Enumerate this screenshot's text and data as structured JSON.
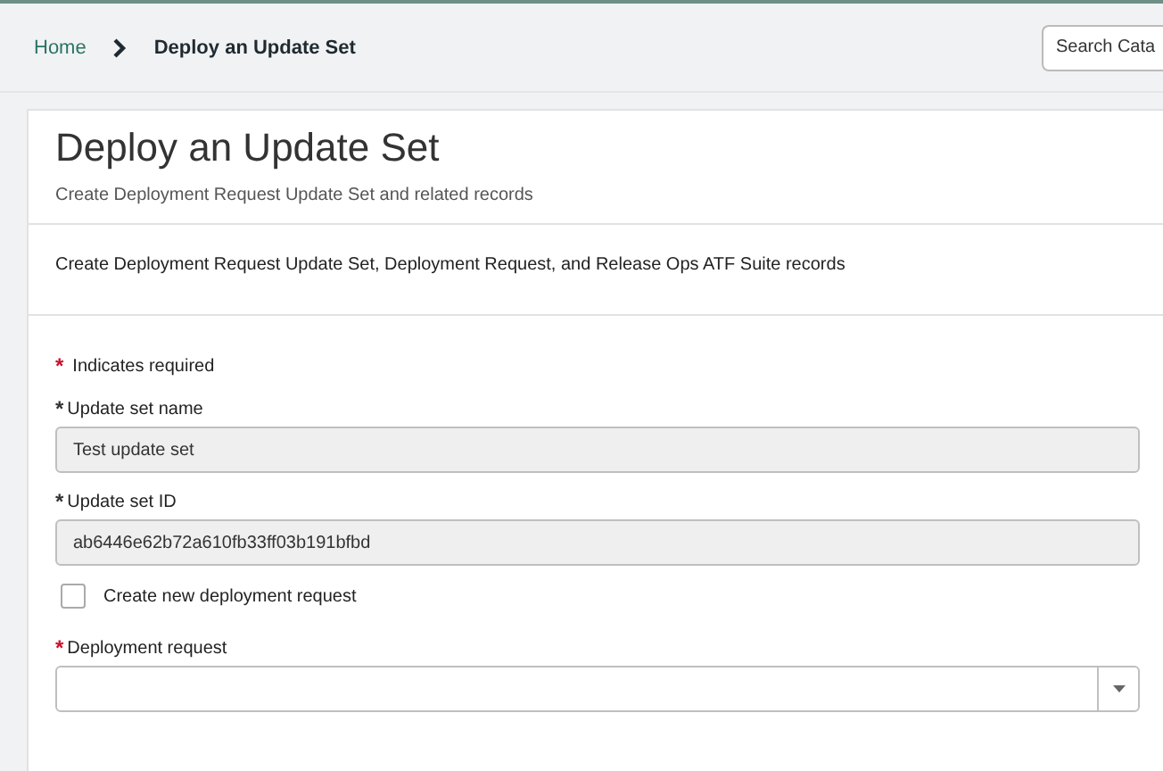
{
  "breadcrumb": [
    {
      "label": "Home",
      "kind": "link"
    },
    {
      "label": "Deploy an Update Set",
      "kind": "current"
    }
  ],
  "search": {
    "placeholder": "Search Cata"
  },
  "card": {
    "title": "Deploy an Update Set",
    "subtitle": "Create Deployment Request Update Set and related records",
    "description": "Create Deployment Request Update Set, Deployment Request, and Release Ops ATF Suite records"
  },
  "required_note": {
    "mark": "*",
    "text": "Indicates required"
  },
  "fields": [
    {
      "kind": "text",
      "mark": "*",
      "satisfied": true,
      "label": "Update set name",
      "value": "Test update set",
      "readonly": true
    },
    {
      "kind": "text",
      "mark": "*",
      "satisfied": true,
      "label": "Update set ID",
      "value": "ab6446e62b72a610fb33ff03b191bfbd",
      "readonly": true
    },
    {
      "kind": "checkbox",
      "label": "Create new deployment request",
      "checked": false
    },
    {
      "kind": "select",
      "mark": "*",
      "satisfied": false,
      "label": "Deployment request"
    }
  ]
}
